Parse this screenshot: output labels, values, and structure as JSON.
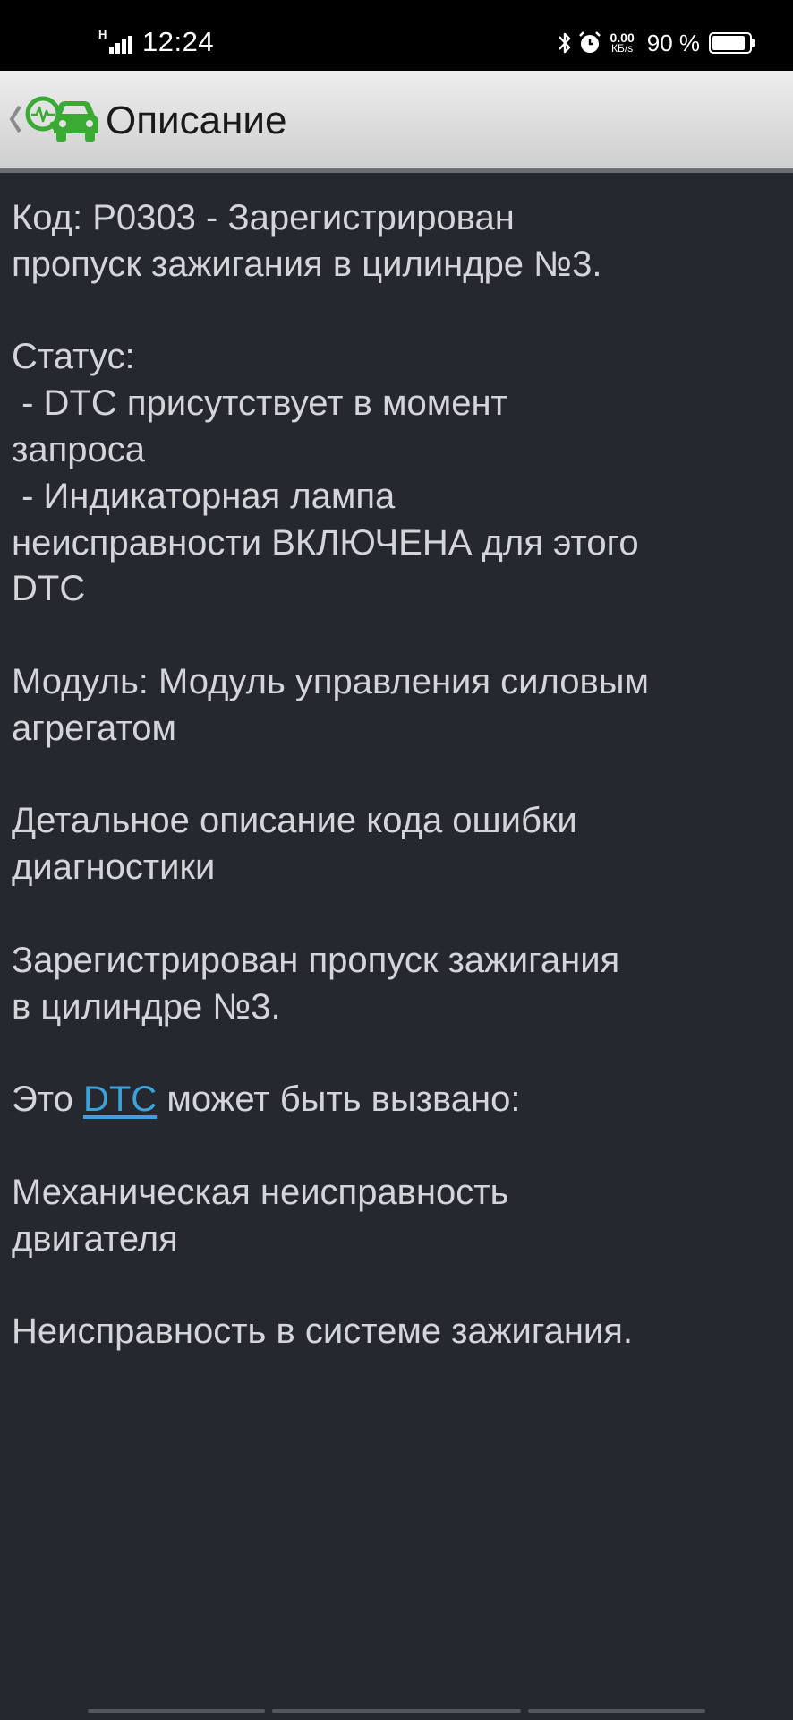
{
  "status_bar": {
    "signal_label": "H",
    "time": "12:24",
    "net_speed_value": "0.00",
    "net_speed_unit": "КБ/s",
    "battery_percent": "90 %",
    "battery_level": 0.9
  },
  "app_bar": {
    "title": "Описание",
    "logo_icon": "car-diagnostics-icon",
    "back_icon": "chevron-left-icon"
  },
  "content": {
    "code_line1": "Код: P0303 - Зарегистрирован",
    "code_line2": "пропуск зажигания в цилиндре №3.",
    "status_heading": "Статус:",
    "status_item1_line1": " - DTC присутствует в момент",
    "status_item1_line2": "запроса",
    "status_item2_line1": " - Индикаторная лампа",
    "status_item2_line2": "неисправности ВКЛЮЧЕНА для этого",
    "status_item2_line3": "DTC",
    "module_line1": "Модуль: Модуль управления силовым",
    "module_line2": "агрегатом",
    "detail_heading_line1": "Детальное описание кода ошибки",
    "detail_heading_line2": "диагностики",
    "detail_text_line1": "Зарегистрирован пропуск зажигания",
    "detail_text_line2": "в цилиндре №3.",
    "cause_prefix": "Это ",
    "cause_link": "DTC",
    "cause_suffix": " может быть вызвано:",
    "cause1_line1": "Механическая неисправность",
    "cause1_line2": "двигателя",
    "cause2": "Неисправность в системе зажигания."
  },
  "colors": {
    "background": "#262830",
    "text": "#d4d5d8",
    "link": "#3ba3db",
    "logo_green": "#3aaa35"
  }
}
